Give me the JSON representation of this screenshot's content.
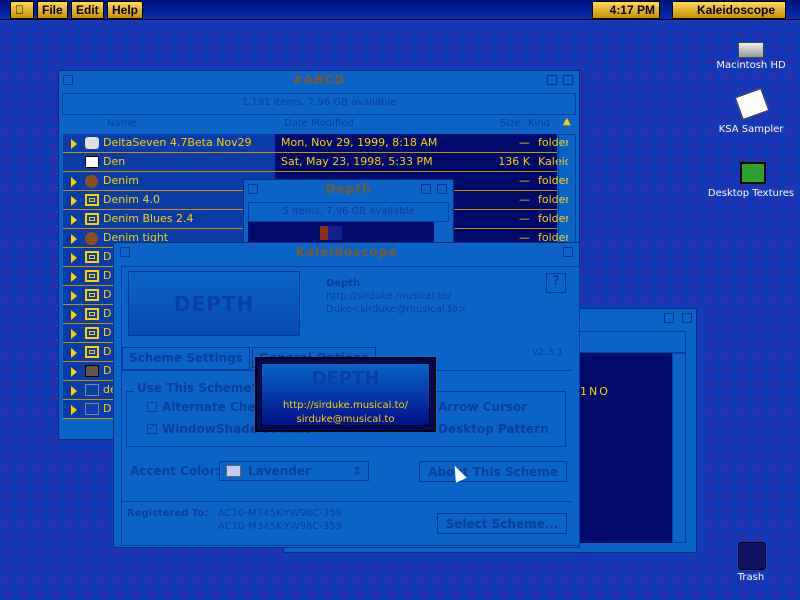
{
  "menubar": {
    "items": [
      "File",
      "Edit",
      "Help"
    ],
    "clock": "4:17 PM",
    "app": "Kaleidoscope"
  },
  "desktop": {
    "icons": [
      "Macintosh HD",
      "KSA Sampler",
      "Desktop Textures",
      "Trash"
    ]
  },
  "main_window": {
    "title": "#ABCD",
    "info": "1,191 items, 7.96 GB available",
    "columns": [
      "Name",
      "Date Modified",
      "Size",
      "Kind"
    ],
    "rows": [
      {
        "name": "DeltaSeven 4.7Beta Nov29",
        "date": "Mon, Nov 29, 1999, 8:18 AM",
        "size": "—",
        "kind": "folder",
        "icon": "disk-icon"
      },
      {
        "name": "Den",
        "date": "Sat, May 23, 1998, 5:33 PM",
        "size": "136 K",
        "kind": "Kaleido",
        "icon": "scheme-file-icon"
      },
      {
        "name": "Denim",
        "date": "",
        "size": "—",
        "kind": "folder",
        "icon": "ball-icon"
      },
      {
        "name": "Denim 4.0",
        "date": "",
        "size": "—",
        "kind": "folder",
        "icon": "folder-icon"
      },
      {
        "name": "Denim Blues 2.4",
        "date": "",
        "size": "—",
        "kind": "folder",
        "icon": "folder-icon"
      },
      {
        "name": "Denim tight",
        "date": "",
        "size": "—",
        "kind": "folder",
        "icon": "ball-icon"
      },
      {
        "name": "D",
        "icon": "folder-icon"
      },
      {
        "name": "D",
        "icon": "folder-icon"
      },
      {
        "name": "D",
        "icon": "folder-icon"
      },
      {
        "name": "D",
        "icon": "folder-icon"
      },
      {
        "name": "D",
        "icon": "folder-icon"
      },
      {
        "name": "D",
        "icon": "folder-icon"
      },
      {
        "name": "D",
        "icon": "picture-icon"
      },
      {
        "name": "de",
        "icon": "alias-icon"
      },
      {
        "name": "D",
        "icon": "alias-icon"
      }
    ]
  },
  "depth_window": {
    "title": "Depth",
    "info": "5 items, 7.96 GB available"
  },
  "back_window": {
    "text": "1NO"
  },
  "kaleidoscope": {
    "title": "Kaleidoscope",
    "scheme_name": "Depth",
    "url": "http://sirduke.musical.to/",
    "author": "Duke<sirduke@musical.to>",
    "version": "v2.3.1",
    "tabs": [
      "Scheme Settings",
      "General Options"
    ],
    "group_label": "Use This Scheme's:",
    "options": [
      {
        "label": "Alternate Checkboxes",
        "checked": false
      },
      {
        "label": "WindowShade Sounds",
        "checked": true
      },
      {
        "label": "Arrow Cursor",
        "checked": false
      },
      {
        "label": "Desktop Pattern",
        "checked": false
      }
    ],
    "accent_label": "Accent Color:",
    "accent_value": "Lavender",
    "about_button": "About This Scheme",
    "registered_label": "Registered To:",
    "registration": [
      "AC10-M345K-YW98C-359",
      "AC10-M345K-YW98C-359"
    ],
    "select_button": "Select Scheme...",
    "logo": "DEPTH"
  },
  "popup": {
    "url": "http://sirduke.musical.to/",
    "email": "sirduke@musical.to"
  }
}
